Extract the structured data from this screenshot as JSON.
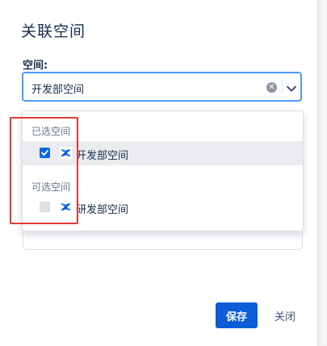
{
  "dialog": {
    "title": "关联空间",
    "field_label": "空间:",
    "select": {
      "value": "开发部空间",
      "clear_icon": "clear-circle-icon",
      "toggle_icon": "chevron-down-icon"
    },
    "dropdown": {
      "selected_group_label": "已选空间",
      "selected_items": [
        {
          "label": "开发部空间",
          "checked": true,
          "icon": "confluence-space-icon"
        }
      ],
      "available_group_label": "可选空间",
      "available_items": [
        {
          "label": "研发部空间",
          "checked": false,
          "icon": "confluence-space-icon"
        }
      ]
    },
    "buttons": {
      "save": "保存",
      "close": "关闭"
    }
  },
  "colors": {
    "primary": "#0b5cd6",
    "focus_border": "#4c9aff",
    "annotation_red": "#e53935"
  }
}
